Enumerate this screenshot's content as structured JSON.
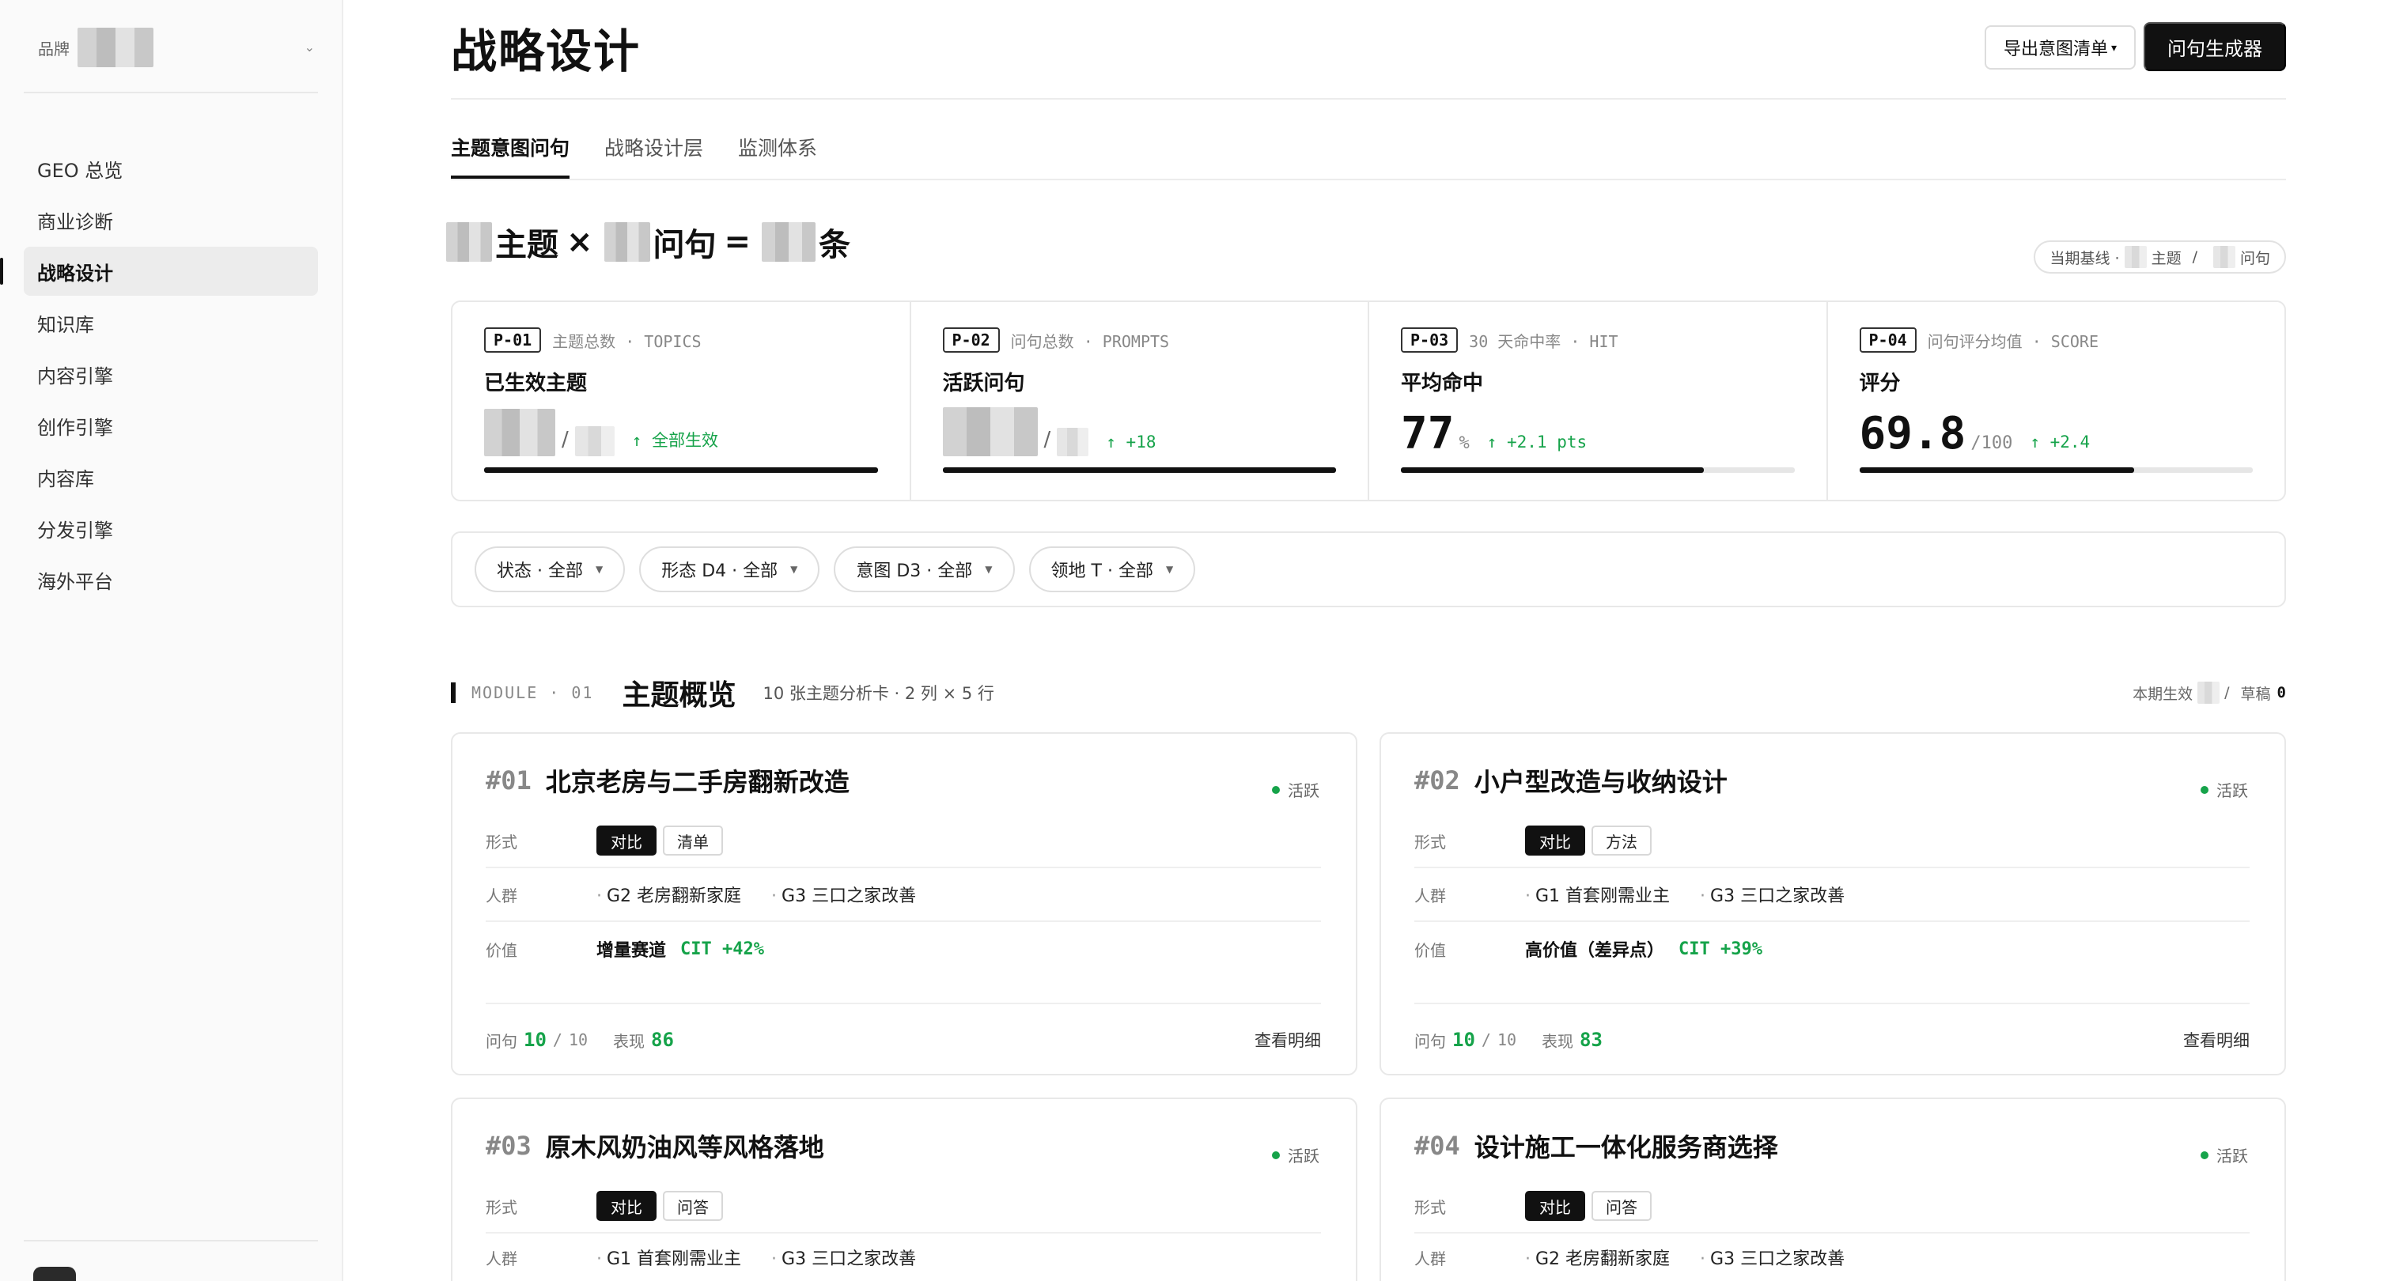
{
  "sidebar": {
    "brand_label": "品牌",
    "items": [
      {
        "label": "GEO 总览"
      },
      {
        "label": "商业诊断"
      },
      {
        "label": "战略设计",
        "active": true
      },
      {
        "label": "知识库"
      },
      {
        "label": "内容引擎"
      },
      {
        "label": "创作引擎"
      },
      {
        "label": "内容库"
      },
      {
        "label": "分发引擎"
      },
      {
        "label": "海外平台"
      }
    ]
  },
  "header": {
    "title": "战略设计",
    "export_label": "导出意图清单",
    "generate_label": "问句生成器"
  },
  "tabs": [
    {
      "label": "主题意图问句",
      "active": true
    },
    {
      "label": "战略设计层"
    },
    {
      "label": "监测体系"
    }
  ],
  "formula": {
    "topic_word": "主题",
    "times": "×",
    "prompt_word": "问句",
    "equals": "=",
    "count_word": "条"
  },
  "baseline": {
    "label": "当期基线 ·",
    "topic_word": "主题",
    "sep": "/",
    "prompt_word": "问句"
  },
  "stats": [
    {
      "code": "P-01",
      "meta": "主题总数 · TOPICS",
      "label": "已生效主题",
      "delta": "↑ 全部生效",
      "progress": 1.0
    },
    {
      "code": "P-02",
      "meta": "问句总数 · PROMPTS",
      "label": "活跃问句",
      "delta": "↑ +18",
      "progress": 1.0
    },
    {
      "code": "P-03",
      "meta": "30 天命中率 · HIT",
      "label": "平均命中",
      "value": "77",
      "unit": "%",
      "delta": "↑ +2.1 pts",
      "progress": 0.77
    },
    {
      "code": "P-04",
      "meta": "问句评分均值 · SCORE",
      "label": "评分",
      "value": "69.8",
      "unit": "/100",
      "delta": "↑ +2.4",
      "progress": 0.698
    }
  ],
  "filters": [
    {
      "label": "状态 · 全部"
    },
    {
      "label": "形态 D4 · 全部"
    },
    {
      "label": "意图 D3 · 全部"
    },
    {
      "label": "领地 T · 全部"
    }
  ],
  "module": {
    "tag": "MODULE · 01",
    "title": "主题概览",
    "desc": "10 张主题分析卡 · 2 列 × 5 行",
    "right_label": "本期生效",
    "right_sep": "/",
    "draft_label": "草稿",
    "draft_count": "0"
  },
  "card_labels": {
    "form": "形式",
    "audience": "人群",
    "value": "价值",
    "prompts": "问句",
    "of": "/",
    "perf": "表现",
    "detail": "查看明细"
  },
  "cards": [
    {
      "num": "#01",
      "title": "北京老房与二手房翻新改造",
      "status": "活跃",
      "forms": [
        "对比",
        "清单"
      ],
      "audiences": [
        "G2 老房翻新家庭",
        "G3 三口之家改善"
      ],
      "value_text": "增量赛道",
      "cit": "CIT +42%",
      "prompts": "10",
      "prompts_total": "10",
      "perf": "86"
    },
    {
      "num": "#02",
      "title": "小户型改造与收纳设计",
      "status": "活跃",
      "forms": [
        "对比",
        "方法"
      ],
      "audiences": [
        "G1 首套刚需业主",
        "G3 三口之家改善"
      ],
      "value_text": "高价值（差异点）",
      "cit": "CIT +39%",
      "prompts": "10",
      "prompts_total": "10",
      "perf": "83"
    },
    {
      "num": "#03",
      "title": "原木风奶油风等风格落地",
      "status": "活跃",
      "forms": [
        "对比",
        "问答"
      ],
      "audiences": [
        "G1 首套刚需业主",
        "G3 三口之家改善"
      ]
    },
    {
      "num": "#04",
      "title": "设计施工一体化服务商选择",
      "status": "活跃",
      "forms": [
        "对比",
        "问答"
      ],
      "audiences": [
        "G2 老房翻新家庭",
        "G3 三口之家改善"
      ]
    }
  ],
  "colors": {
    "accent": "#111111",
    "positive": "#16a34a"
  }
}
